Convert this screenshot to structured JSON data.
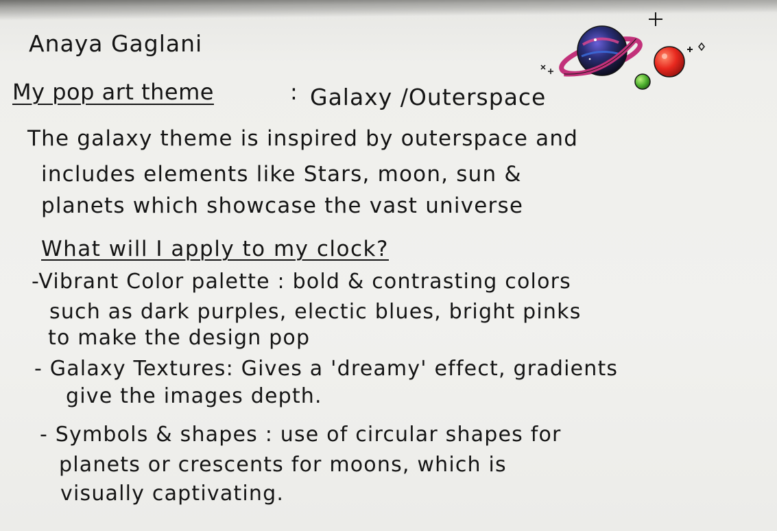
{
  "document": {
    "author": "Anaya Gaglani",
    "theme_label": "My pop art theme",
    "theme_colon": ":",
    "theme_value": "Galaxy /Outerspace",
    "intro_lines": [
      "The galaxy theme is inspired by outerspace and",
      "includes elements like Stars, moon, sun &",
      "planets which showcase the vast universe"
    ],
    "question": "What will I apply to my clock?",
    "bullet_lines": [
      "-Vibrant Color palette : bold & contrasting colors",
      "such as dark purples, electic blues, bright pinks",
      "to make the design pop",
      "- Galaxy Textures: Gives a 'dreamy' effect, gradients",
      "give the images depth.",
      "- Symbols & shapes : use of circular shapes for",
      "planets or crescents for moons, which is",
      "visually captivating."
    ]
  },
  "illustration": {
    "icons": [
      "ringed-planet-icon",
      "red-planet-icon",
      "green-planet-icon",
      "sparkle-star-icon"
    ],
    "colors": {
      "ringed_planet": "#2a2f7a",
      "ring": "#c2317a",
      "red_planet": "#e8281e",
      "green_planet": "#4caf2e",
      "ink": "#141414",
      "paper": "#f1f1ee"
    }
  }
}
